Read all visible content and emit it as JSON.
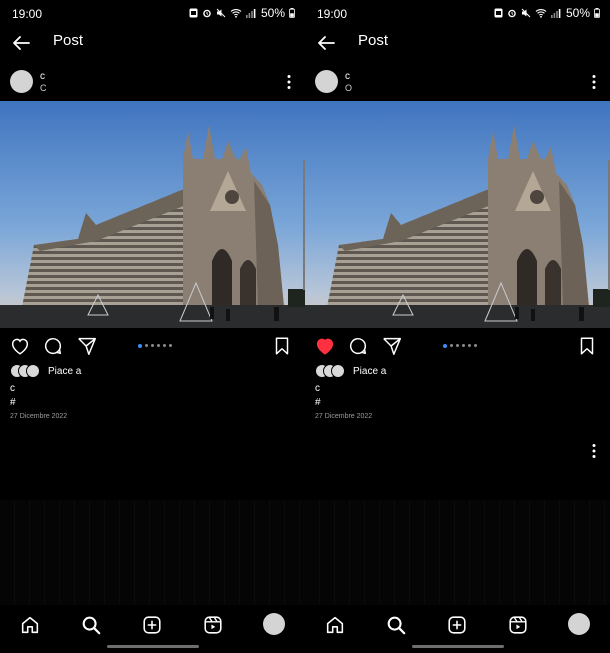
{
  "screens": [
    {
      "status": {
        "time": "19:00",
        "battery": "50%"
      },
      "header": {
        "title": "Post"
      },
      "post": {
        "username": "c",
        "subtitle": "C",
        "liked": false,
        "carousel": {
          "count": 6,
          "active_index": 0
        },
        "likes_text": "Piace a",
        "caption_user": "c",
        "caption_hashtag": "#",
        "date": "27 Dicembre 2022",
        "show_second_menu": false
      }
    },
    {
      "status": {
        "time": "19:00",
        "battery": "50%"
      },
      "header": {
        "title": "Post"
      },
      "post": {
        "username": "c",
        "subtitle": "O",
        "liked": true,
        "carousel": {
          "count": 6,
          "active_index": 0
        },
        "likes_text": "Piace a",
        "caption_user": "c",
        "caption_hashtag": "#",
        "date": "27 Dicembre 2022",
        "show_second_menu": true
      }
    }
  ],
  "icons": {
    "back": "arrow-left-icon",
    "more": "more-vertical-icon",
    "like": "heart-icon",
    "comment": "comment-icon",
    "share": "paper-plane-icon",
    "save": "bookmark-icon",
    "home": "home-icon",
    "search": "search-icon",
    "create": "add-square-icon",
    "reels": "reels-icon"
  },
  "colors": {
    "background": "#000000",
    "text": "#ffffff",
    "like_active": "#ff3040",
    "carousel_active": "#3e8bf5",
    "date": "#9a9a9a"
  }
}
